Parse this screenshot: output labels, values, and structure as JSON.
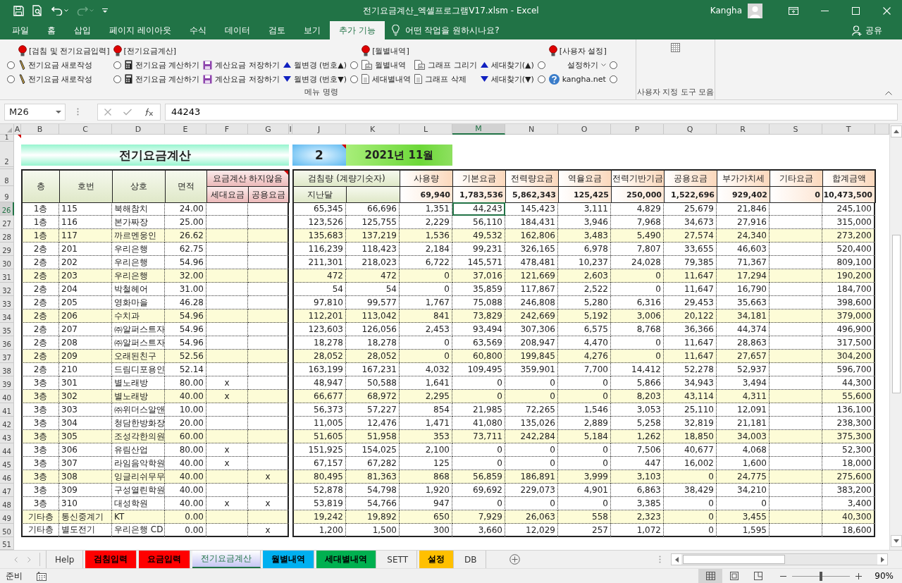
{
  "window": {
    "title": "전기요금계산_엑셀프로그램V17.xlsm  -  Excel",
    "user": "Kangha"
  },
  "ribbon_tabs": [
    {
      "label": "파일",
      "selected": false
    },
    {
      "label": "홈",
      "selected": false
    },
    {
      "label": "삽입",
      "selected": false
    },
    {
      "label": "페이지 레이아웃",
      "selected": false
    },
    {
      "label": "수식",
      "selected": false
    },
    {
      "label": "데이터",
      "selected": false
    },
    {
      "label": "검토",
      "selected": false
    },
    {
      "label": "보기",
      "selected": false
    },
    {
      "label": "추가 기능",
      "selected": true
    }
  ],
  "tell_me": {
    "placeholder": "어떤 작업을 원하시나요?"
  },
  "share": "공유",
  "ribbon": {
    "menu_group": {
      "headers": [
        "[검침 및 전기요금입력]",
        "[전기요금계산]",
        "[월별내역]",
        "[사용자 설정]"
      ],
      "rows": [
        [
          {
            "kind": "radio",
            "selected": false
          },
          {
            "kind": "command",
            "label": "전기요금 새로작성"
          },
          {
            "kind": "radio",
            "selected": false
          },
          {
            "kind": "command",
            "label": "전기요금 계산하기"
          },
          {
            "kind": "command",
            "label": "계산요금 저장하기"
          },
          {
            "kind": "command",
            "label": "월변경 (번호▲)"
          },
          {
            "kind": "radio",
            "selected": false
          },
          {
            "kind": "command",
            "label": "월별내역"
          },
          {
            "kind": "command",
            "label": "그래프 그리기"
          },
          {
            "kind": "command",
            "label": "세대찾기(▲)"
          },
          {
            "kind": "radio",
            "selected": false
          },
          {
            "kind": "dropdown",
            "label": "설정하기"
          },
          {
            "kind": "radio",
            "selected": false
          }
        ],
        [
          {
            "kind": "radio",
            "selected": false
          },
          {
            "kind": "command",
            "label": "전기요금 새로작성"
          },
          {
            "kind": "radio",
            "selected": false
          },
          {
            "kind": "command",
            "label": "전기요금 계산하기"
          },
          {
            "kind": "command",
            "label": "계산요금 저장하기"
          },
          {
            "kind": "command",
            "label": "월변경 (번호▼)"
          },
          {
            "kind": "radio",
            "selected": false
          },
          {
            "kind": "command",
            "label": "세대별내역"
          },
          {
            "kind": "command",
            "label": "그래프 삭제"
          },
          {
            "kind": "command",
            "label": "세대찾기(▼)"
          },
          {
            "kind": "radio",
            "selected": false
          },
          {
            "kind": "command",
            "label": "kangha.net"
          },
          {
            "kind": "radio",
            "selected": false
          }
        ]
      ],
      "label": "메뉴 명령"
    },
    "toolbar_group": {
      "label": "사용자 지정 도구 모음"
    }
  },
  "formula_bar": {
    "name_box": "M26",
    "value": "44243"
  },
  "columns": [
    {
      "label": "A",
      "selected": false
    },
    {
      "label": "B",
      "selected": false
    },
    {
      "label": "C",
      "selected": false
    },
    {
      "label": "D",
      "selected": false
    },
    {
      "label": "E",
      "selected": false
    },
    {
      "label": "F",
      "selected": false
    },
    {
      "label": "G",
      "selected": false
    },
    {
      "label": "I",
      "selected": false
    },
    {
      "label": "J",
      "selected": false
    },
    {
      "label": "K",
      "selected": false
    },
    {
      "label": "L",
      "selected": false
    },
    {
      "label": "M",
      "selected": true
    },
    {
      "label": "N",
      "selected": false
    },
    {
      "label": "O",
      "selected": false
    },
    {
      "label": "P",
      "selected": false
    },
    {
      "label": "Q",
      "selected": false
    },
    {
      "label": "R",
      "selected": false
    },
    {
      "label": "S",
      "selected": false
    },
    {
      "label": "T",
      "selected": false
    }
  ],
  "sheet": {
    "row_numbers": [
      "1",
      "2",
      "8",
      "9"
    ],
    "title": "전기요금계산",
    "number": "2",
    "month": "2021년 11월",
    "left_headers": [
      "층",
      "호번",
      "상호",
      "면적"
    ],
    "exclude": {
      "label": "요금계산 하지않음",
      "household": "세대요금",
      "common": "공용요금"
    },
    "meter": {
      "label": "검침량 (계량기숫자)",
      "prev": "지난달"
    },
    "fee_headers": [
      "사용량",
      "기본요금",
      "전력량요금",
      "역율요금",
      "전력기반기금",
      "공용요금",
      "부가가치세",
      "기타요금",
      "합계금액"
    ],
    "summary": [
      "69,940",
      "1,783,536",
      "5,862,343",
      "125,425",
      "250,000",
      "1,522,696",
      "929,402",
      "0",
      "10,473,500"
    ],
    "rows": [
      {
        "row": "26",
        "floor": "1층",
        "unit": "115",
        "name": "북해참치",
        "area": "24.00",
        "values": [
          "65,345",
          "66,696",
          "1,351",
          "44,243",
          "145,423",
          "3,111",
          "4,829",
          "25,679",
          "21,846"
        ],
        "total": "245,100",
        "highlighted": false,
        "active": true
      },
      {
        "row": "27",
        "floor": "1층",
        "unit": "116",
        "name": "본가짜장",
        "area": "25.00",
        "values": [
          "123,526",
          "125,755",
          "2,229",
          "56,110",
          "184,431",
          "3,946",
          "7,968",
          "34,673",
          "27,916"
        ],
        "total": "315,000",
        "highlighted": false,
        "active": false
      },
      {
        "row": "28",
        "floor": "1층",
        "unit": "117",
        "name": "까르멘웅인",
        "area": "26.62",
        "values": [
          "135,683",
          "137,219",
          "1,536",
          "49,532",
          "162,806",
          "3,483",
          "5,490",
          "27,574",
          "24,340"
        ],
        "total": "273,200",
        "highlighted": true,
        "active": false
      },
      {
        "row": "29",
        "floor": "2층",
        "unit": "201",
        "name": "우리은행",
        "area": "62.75",
        "values": [
          "116,239",
          "118,423",
          "2,184",
          "99,231",
          "326,165",
          "6,978",
          "7,807",
          "33,655",
          "46,603"
        ],
        "total": "520,400",
        "highlighted": false,
        "active": false
      },
      {
        "row": "30",
        "floor": "2층",
        "unit": "202",
        "name": "우리은행",
        "area": "54.96",
        "values": [
          "211,301",
          "218,023",
          "6,722",
          "145,571",
          "478,481",
          "10,237",
          "24,028",
          "79,385",
          "71,367"
        ],
        "total": "809,100",
        "highlighted": false,
        "active": false
      },
      {
        "row": "31",
        "floor": "2층",
        "unit": "203",
        "name": "우리은행",
        "area": "32.00",
        "values": [
          "472",
          "472",
          "0",
          "37,016",
          "121,669",
          "2,603",
          "0",
          "11,647",
          "17,294"
        ],
        "total": "190,200",
        "highlighted": true,
        "active": false
      },
      {
        "row": "32",
        "floor": "2층",
        "unit": "204",
        "name": "박철헤어",
        "area": "31.00",
        "values": [
          "54",
          "54",
          "0",
          "35,859",
          "117,867",
          "2,522",
          "0",
          "11,647",
          "16,790"
        ],
        "total": "184,700",
        "highlighted": false,
        "active": false
      },
      {
        "row": "33",
        "floor": "2층",
        "unit": "205",
        "name": "영화마을",
        "area": "46.28",
        "values": [
          "97,810",
          "99,577",
          "1,767",
          "75,088",
          "246,808",
          "5,280",
          "6,316",
          "29,453",
          "35,663"
        ],
        "total": "398,600",
        "highlighted": false,
        "active": false
      },
      {
        "row": "34",
        "floor": "2층",
        "unit": "206",
        "name": "수치과",
        "area": "54.96",
        "values": [
          "112,201",
          "113,042",
          "841",
          "73,829",
          "242,669",
          "5,192",
          "3,006",
          "20,122",
          "34,181"
        ],
        "total": "379,000",
        "highlighted": true,
        "active": false
      },
      {
        "row": "35",
        "floor": "2층",
        "unit": "207",
        "name": "㈜알퍼스트자",
        "area": "54.96",
        "values": [
          "123,603",
          "126,056",
          "2,453",
          "93,494",
          "307,306",
          "6,575",
          "8,768",
          "36,366",
          "44,374"
        ],
        "total": "496,900",
        "highlighted": false,
        "active": false
      },
      {
        "row": "36",
        "floor": "2층",
        "unit": "208",
        "name": "㈜알퍼스트자",
        "area": "54.96",
        "values": [
          "18,278",
          "18,278",
          "0",
          "63,569",
          "208,947",
          "4,470",
          "0",
          "11,647",
          "28,863"
        ],
        "total": "317,500",
        "highlighted": false,
        "active": false
      },
      {
        "row": "37",
        "floor": "2층",
        "unit": "209",
        "name": "오래된친구",
        "area": "52.56",
        "values": [
          "28,052",
          "28,052",
          "0",
          "60,800",
          "199,845",
          "4,276",
          "0",
          "11,647",
          "27,657"
        ],
        "total": "304,200",
        "highlighted": true,
        "active": false
      },
      {
        "row": "38",
        "floor": "2층",
        "unit": "210",
        "name": "드림디포용인",
        "area": "52.14",
        "values": [
          "163,199",
          "167,231",
          "4,032",
          "109,495",
          "359,901",
          "7,700",
          "14,412",
          "52,278",
          "52,937"
        ],
        "total": "596,700",
        "highlighted": false,
        "active": false
      },
      {
        "row": "39",
        "floor": "3층",
        "unit": "301",
        "name": "별노래방",
        "area": "80.00",
        "household": "x",
        "values": [
          "48,947",
          "50,588",
          "1,641",
          "0",
          "0",
          "0",
          "5,866",
          "34,943",
          "3,494"
        ],
        "total": "44,300",
        "highlighted": false,
        "active": false
      },
      {
        "row": "40",
        "floor": "3층",
        "unit": "302",
        "name": "별노래방",
        "area": "40.00",
        "household": "x",
        "values": [
          "66,677",
          "68,972",
          "2,295",
          "0",
          "0",
          "0",
          "8,203",
          "43,114",
          "4,311"
        ],
        "total": "55,600",
        "highlighted": true,
        "active": false
      },
      {
        "row": "41",
        "floor": "3층",
        "unit": "303",
        "name": "㈜위더스알앤",
        "area": "10.00",
        "values": [
          "56,373",
          "57,227",
          "854",
          "21,985",
          "72,265",
          "1,546",
          "3,053",
          "25,110",
          "12,091"
        ],
        "total": "136,100",
        "highlighted": false,
        "active": false
      },
      {
        "row": "42",
        "floor": "3층",
        "unit": "304",
        "name": "청담한방화장",
        "area": "20.00",
        "values": [
          "11,005",
          "12,476",
          "1,471",
          "41,080",
          "135,026",
          "2,889",
          "5,258",
          "32,819",
          "21,181"
        ],
        "total": "238,300",
        "highlighted": false,
        "active": false
      },
      {
        "row": "43",
        "floor": "3층",
        "unit": "305",
        "name": "조성각한의원",
        "area": "60.00",
        "values": [
          "51,605",
          "51,958",
          "353",
          "73,711",
          "242,284",
          "5,184",
          "1,262",
          "18,850",
          "34,003"
        ],
        "total": "375,300",
        "highlighted": true,
        "active": false
      },
      {
        "row": "44",
        "floor": "3층",
        "unit": "306",
        "name": "유림산업",
        "area": "80.00",
        "household": "x",
        "values": [
          "151,925",
          "154,025",
          "2,100",
          "0",
          "0",
          "0",
          "7,506",
          "40,677",
          "4,068"
        ],
        "total": "52,300",
        "highlighted": false,
        "active": false
      },
      {
        "row": "45",
        "floor": "3층",
        "unit": "307",
        "name": "라임음악학원",
        "area": "40.00",
        "household": "x",
        "values": [
          "67,157",
          "67,282",
          "125",
          "0",
          "0",
          "0",
          "447",
          "16,002",
          "1,600"
        ],
        "total": "18,000",
        "highlighted": false,
        "active": false
      },
      {
        "row": "46",
        "floor": "3층",
        "unit": "308",
        "name": "잉글리쉬무무",
        "area": "40.00",
        "common": "x",
        "values": [
          "80,495",
          "81,363",
          "868",
          "56,859",
          "186,891",
          "3,999",
          "3,103",
          "0",
          "24,775"
        ],
        "total": "275,600",
        "highlighted": true,
        "active": false
      },
      {
        "row": "47",
        "floor": "3층",
        "unit": "309",
        "name": "구성열린학원",
        "area": "40.00",
        "values": [
          "52,878",
          "54,798",
          "1,920",
          "69,692",
          "229,073",
          "4,901",
          "6,863",
          "38,429",
          "34,210"
        ],
        "total": "383,200",
        "highlighted": false,
        "active": false
      },
      {
        "row": "48",
        "floor": "3층",
        "unit": "310",
        "name": "대성학원",
        "area": "40.00",
        "household": "x",
        "common": "x",
        "values": [
          "53,819",
          "54,766",
          "947",
          "0",
          "0",
          "0",
          "3,385",
          "0",
          "0"
        ],
        "total": "3,400",
        "highlighted": false,
        "active": false
      },
      {
        "row": "49",
        "floor": "기타층",
        "unit": "통신중계기",
        "name": "KT",
        "area": "0.00",
        "values": [
          "19,242",
          "19,892",
          "650",
          "7,929",
          "26,063",
          "558",
          "2,323",
          "0",
          "3,455"
        ],
        "total": "40,300",
        "highlighted": true,
        "active": false
      },
      {
        "row": "50",
        "floor": "기타층",
        "unit": "별도전기",
        "name": "우리은행 CD",
        "area": "0.00",
        "common": "x",
        "values": [
          "1,200",
          "1,500",
          "300",
          "3,660",
          "12,029",
          "257",
          "1,072",
          "0",
          "1,595"
        ],
        "total": "18,600",
        "highlighted": false,
        "active": false
      }
    ],
    "last_row": "51"
  },
  "sheet_tabs": [
    {
      "label": "Help",
      "selected": false
    },
    {
      "label": "검침입력",
      "selected": false,
      "color": "#ff0000"
    },
    {
      "label": "요금입력",
      "selected": false,
      "color": "#ff0000"
    },
    {
      "label": "전기요금계산",
      "selected": true
    },
    {
      "label": "월별내역",
      "selected": false,
      "color": "#00b0f0"
    },
    {
      "label": "세대별내역",
      "selected": false,
      "color": "#00b050"
    },
    {
      "label": "SETT",
      "selected": false
    },
    {
      "label": "설정",
      "selected": false,
      "color": "#ffc000"
    },
    {
      "label": "DB",
      "selected": false
    }
  ],
  "status_bar": {
    "status": "준비",
    "views": [
      {
        "kind": "normal",
        "selected": true
      },
      {
        "kind": "page_layout",
        "selected": false
      },
      {
        "kind": "page_break",
        "selected": false
      }
    ],
    "zoom_slider": {
      "level": 0.5
    },
    "zoom": "90%"
  }
}
